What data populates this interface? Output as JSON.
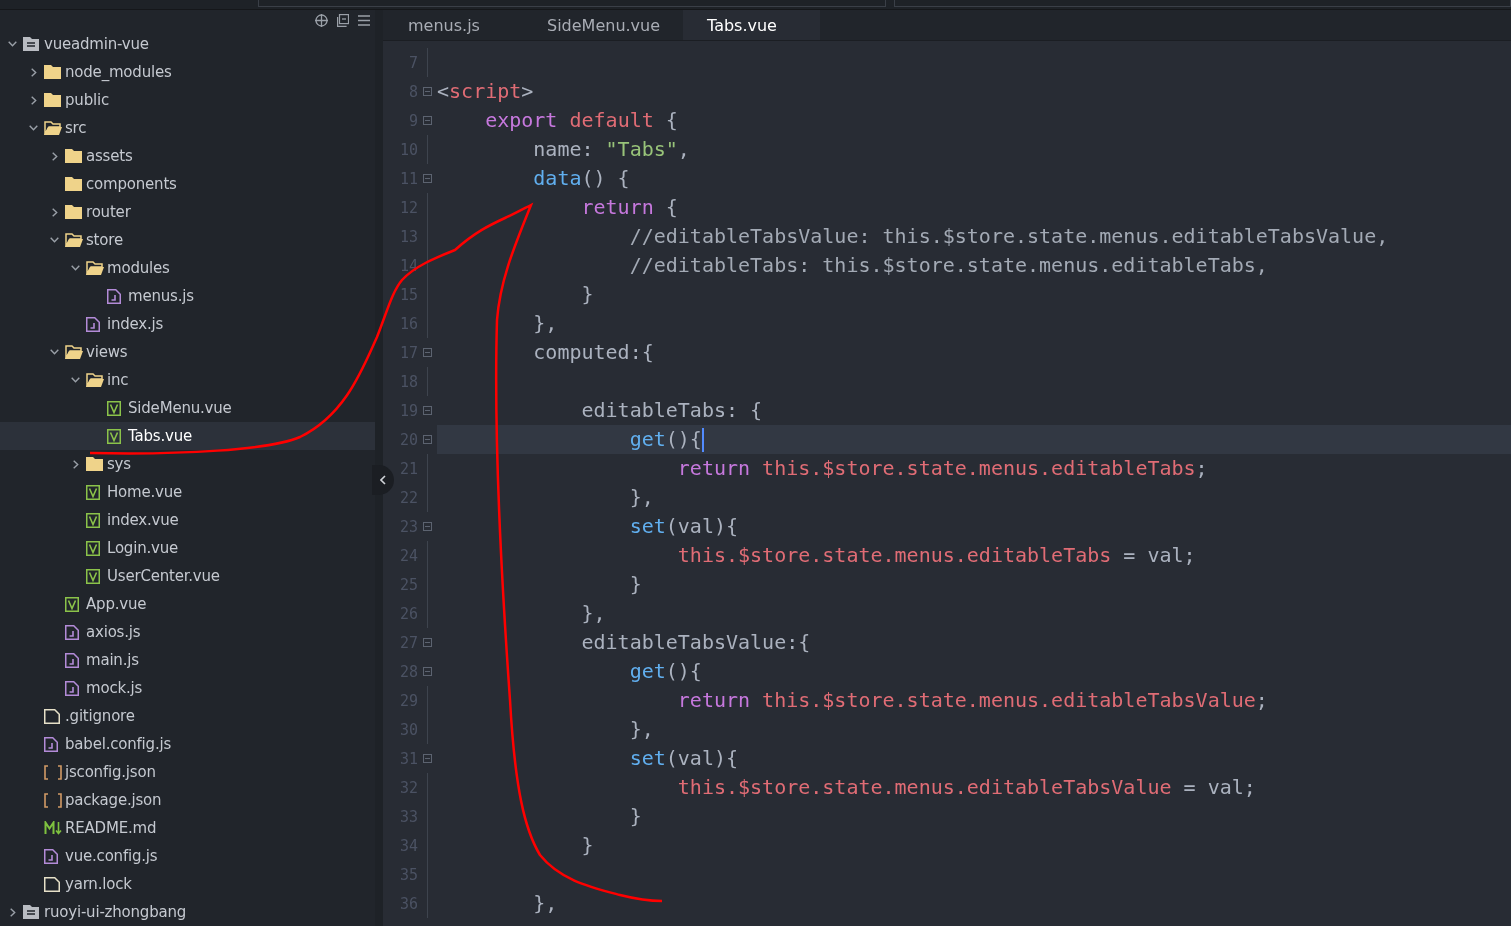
{
  "explorer": {
    "tree": [
      {
        "label": "vueadmin-vue",
        "kind": "project",
        "expanded": true,
        "expandable": true,
        "selected": false,
        "children": [
          {
            "label": "node_modules",
            "kind": "folder",
            "expanded": false,
            "expandable": true,
            "selected": false
          },
          {
            "label": "public",
            "kind": "folder",
            "expanded": false,
            "expandable": true,
            "selected": false
          },
          {
            "label": "src",
            "kind": "folder",
            "expanded": true,
            "expandable": true,
            "selected": false,
            "children": [
              {
                "label": "assets",
                "kind": "folder",
                "expanded": false,
                "expandable": true,
                "selected": false
              },
              {
                "label": "components",
                "kind": "folder",
                "expanded": false,
                "expandable": false,
                "selected": false
              },
              {
                "label": "router",
                "kind": "folder",
                "expanded": false,
                "expandable": true,
                "selected": false
              },
              {
                "label": "store",
                "kind": "folder",
                "expanded": true,
                "expandable": true,
                "selected": false,
                "children": [
                  {
                    "label": "modules",
                    "kind": "folder",
                    "expanded": true,
                    "expandable": true,
                    "selected": false,
                    "children": [
                      {
                        "label": "menus.js",
                        "kind": "js",
                        "selected": false
                      }
                    ]
                  },
                  {
                    "label": "index.js",
                    "kind": "js",
                    "selected": false
                  }
                ]
              },
              {
                "label": "views",
                "kind": "folder",
                "expanded": true,
                "expandable": true,
                "selected": false,
                "children": [
                  {
                    "label": "inc",
                    "kind": "folder",
                    "expanded": true,
                    "expandable": true,
                    "selected": false,
                    "children": [
                      {
                        "label": "SideMenu.vue",
                        "kind": "vue",
                        "selected": false
                      },
                      {
                        "label": "Tabs.vue",
                        "kind": "vue",
                        "selected": true
                      }
                    ]
                  },
                  {
                    "label": "sys",
                    "kind": "folder",
                    "expanded": false,
                    "expandable": true,
                    "selected": false
                  },
                  {
                    "label": "Home.vue",
                    "kind": "vue",
                    "selected": false
                  },
                  {
                    "label": "index.vue",
                    "kind": "vue",
                    "selected": false
                  },
                  {
                    "label": "Login.vue",
                    "kind": "vue",
                    "selected": false
                  },
                  {
                    "label": "UserCenter.vue",
                    "kind": "vue",
                    "selected": false
                  }
                ]
              },
              {
                "label": "App.vue",
                "kind": "vue",
                "selected": false
              },
              {
                "label": "axios.js",
                "kind": "js",
                "selected": false
              },
              {
                "label": "main.js",
                "kind": "js",
                "selected": false
              },
              {
                "label": "mock.js",
                "kind": "js",
                "selected": false
              }
            ]
          },
          {
            "label": ".gitignore",
            "kind": "file",
            "selected": false
          },
          {
            "label": "babel.config.js",
            "kind": "js",
            "selected": false
          },
          {
            "label": "jsconfig.json",
            "kind": "json",
            "selected": false
          },
          {
            "label": "package.json",
            "kind": "json",
            "selected": false
          },
          {
            "label": "README.md",
            "kind": "md",
            "selected": false
          },
          {
            "label": "vue.config.js",
            "kind": "js",
            "selected": false
          },
          {
            "label": "yarn.lock",
            "kind": "file",
            "selected": false
          }
        ]
      },
      {
        "label": "ruoyi-ui-zhongbang",
        "kind": "project",
        "expanded": false,
        "expandable": true,
        "selected": false
      }
    ]
  },
  "tabs": [
    {
      "label": "menus.js",
      "selected": false
    },
    {
      "label": "SideMenu.vue",
      "selected": false
    },
    {
      "label": "Tabs.vue",
      "selected": true
    }
  ],
  "editor": {
    "lines": [
      {
        "number": "7",
        "fold": false,
        "current": false
      },
      {
        "number": "8",
        "fold": true,
        "current": false,
        "tokens": [
          {
            "kind": "punct",
            "text": "<"
          },
          {
            "kind": "tag",
            "text": "script"
          },
          {
            "kind": "punct",
            "text": ">"
          }
        ]
      },
      {
        "number": "9",
        "fold": true,
        "current": false,
        "tokens": [
          {
            "kind": "keyword",
            "text": "    export"
          },
          {
            "kind": "red",
            "text": " default"
          },
          {
            "kind": "plain",
            "text": " {"
          }
        ]
      },
      {
        "number": "10",
        "fold": false,
        "current": false,
        "tokens": [
          {
            "kind": "plain",
            "text": "        name: "
          },
          {
            "kind": "string",
            "text": "\"Tabs\""
          },
          {
            "kind": "plain",
            "text": ","
          }
        ]
      },
      {
        "number": "11",
        "fold": true,
        "current": false,
        "tokens": [
          {
            "kind": "func",
            "text": "        data"
          },
          {
            "kind": "plain",
            "text": "() {"
          }
        ]
      },
      {
        "number": "12",
        "fold": false,
        "current": false,
        "tokens": [
          {
            "kind": "keyword",
            "text": "            return"
          },
          {
            "kind": "plain",
            "text": " {"
          }
        ]
      },
      {
        "number": "13",
        "fold": false,
        "current": false,
        "tokens": [
          {
            "kind": "comment",
            "text": "                //editableTabsValue: this.$store.state.menus.editableTabsValue,"
          }
        ]
      },
      {
        "number": "14",
        "fold": false,
        "current": false,
        "tokens": [
          {
            "kind": "comment",
            "text": "                //editableTabs: this.$store.state.menus.editableTabs,"
          }
        ]
      },
      {
        "number": "15",
        "fold": false,
        "current": false,
        "tokens": [
          {
            "kind": "plain",
            "text": "            }"
          }
        ]
      },
      {
        "number": "16",
        "fold": false,
        "current": false,
        "tokens": [
          {
            "kind": "plain",
            "text": "        },"
          }
        ]
      },
      {
        "number": "17",
        "fold": true,
        "current": false,
        "tokens": [
          {
            "kind": "plain",
            "text": "        computed:{"
          }
        ]
      },
      {
        "number": "18",
        "fold": false,
        "current": false
      },
      {
        "number": "19",
        "fold": true,
        "current": false,
        "tokens": [
          {
            "kind": "plain",
            "text": "            editableTabs: {"
          }
        ]
      },
      {
        "number": "20",
        "fold": true,
        "current": true,
        "tokens": [
          {
            "kind": "func",
            "text": "                get"
          },
          {
            "kind": "plain",
            "text": "(){"
          }
        ]
      },
      {
        "number": "21",
        "fold": false,
        "current": false,
        "tokens": [
          {
            "kind": "keyword",
            "text": "                    return"
          },
          {
            "kind": "red",
            "text": " this.$store.state.menus.editableTabs"
          },
          {
            "kind": "plain",
            "text": ";"
          }
        ]
      },
      {
        "number": "22",
        "fold": false,
        "current": false,
        "tokens": [
          {
            "kind": "plain",
            "text": "                },"
          }
        ]
      },
      {
        "number": "23",
        "fold": true,
        "current": false,
        "tokens": [
          {
            "kind": "func",
            "text": "                set"
          },
          {
            "kind": "plain",
            "text": "(val){"
          }
        ]
      },
      {
        "number": "24",
        "fold": false,
        "current": false,
        "tokens": [
          {
            "kind": "red",
            "text": "                    this.$store.state.menus.editableTabs"
          },
          {
            "kind": "plain",
            "text": " = val;"
          }
        ]
      },
      {
        "number": "25",
        "fold": false,
        "current": false,
        "tokens": [
          {
            "kind": "plain",
            "text": "                }"
          }
        ]
      },
      {
        "number": "26",
        "fold": false,
        "current": false,
        "tokens": [
          {
            "kind": "plain",
            "text": "            },"
          }
        ]
      },
      {
        "number": "27",
        "fold": true,
        "current": false,
        "tokens": [
          {
            "kind": "plain",
            "text": "            editableTabsValue:{"
          }
        ]
      },
      {
        "number": "28",
        "fold": true,
        "current": false,
        "tokens": [
          {
            "kind": "func",
            "text": "                get"
          },
          {
            "kind": "plain",
            "text": "(){"
          }
        ]
      },
      {
        "number": "29",
        "fold": false,
        "current": false,
        "tokens": [
          {
            "kind": "keyword",
            "text": "                    return"
          },
          {
            "kind": "red",
            "text": " this.$store.state.menus.editableTabsValue"
          },
          {
            "kind": "plain",
            "text": ";"
          }
        ]
      },
      {
        "number": "30",
        "fold": false,
        "current": false,
        "tokens": [
          {
            "kind": "plain",
            "text": "                },"
          }
        ]
      },
      {
        "number": "31",
        "fold": true,
        "current": false,
        "tokens": [
          {
            "kind": "func",
            "text": "                set"
          },
          {
            "kind": "plain",
            "text": "(val){"
          }
        ]
      },
      {
        "number": "32",
        "fold": false,
        "current": false,
        "tokens": [
          {
            "kind": "red",
            "text": "                    this.$store.state.menus.editableTabsValue"
          },
          {
            "kind": "plain",
            "text": " = val;"
          }
        ]
      },
      {
        "number": "33",
        "fold": false,
        "current": false,
        "tokens": [
          {
            "kind": "plain",
            "text": "                }"
          }
        ]
      },
      {
        "number": "34",
        "fold": false,
        "current": false,
        "tokens": [
          {
            "kind": "plain",
            "text": "            }"
          }
        ]
      },
      {
        "number": "35",
        "fold": false,
        "current": false
      },
      {
        "number": "36",
        "fold": false,
        "current": false,
        "tokens": [
          {
            "kind": "plain",
            "text": "        },"
          }
        ]
      }
    ]
  },
  "annotation": {
    "kind": "freehand-line",
    "color": "#ff0000"
  }
}
